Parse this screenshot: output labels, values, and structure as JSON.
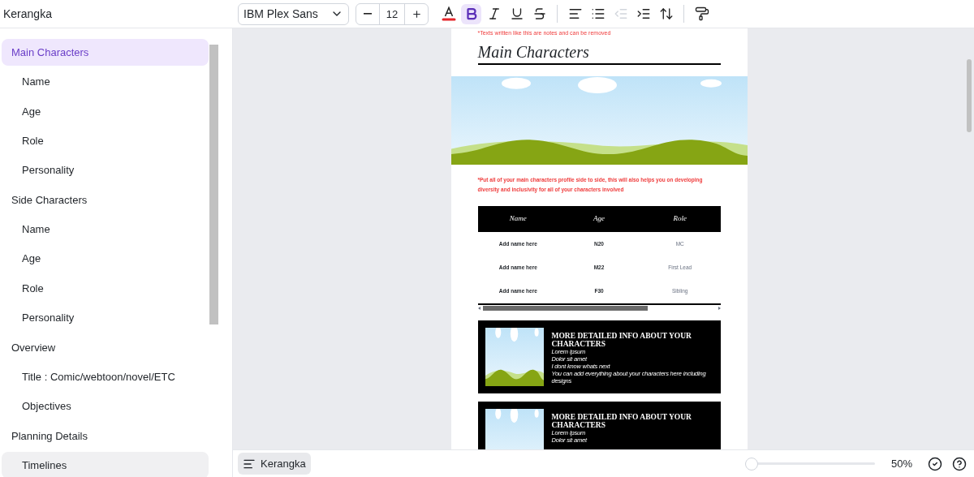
{
  "sidebar": {
    "title": "Kerangka",
    "items": [
      {
        "label": "Main Characters",
        "selected": true,
        "hovered": false,
        "children": [
          {
            "label": "Name",
            "selected": false,
            "hovered": false
          },
          {
            "label": "Age",
            "selected": false,
            "hovered": false
          },
          {
            "label": "Role",
            "selected": false,
            "hovered": false
          },
          {
            "label": "Personality",
            "selected": false,
            "hovered": false
          }
        ]
      },
      {
        "label": "Side Characters",
        "selected": false,
        "hovered": false,
        "children": [
          {
            "label": "Name",
            "selected": false,
            "hovered": false
          },
          {
            "label": "Age",
            "selected": false,
            "hovered": false
          },
          {
            "label": "Role",
            "selected": false,
            "hovered": false
          },
          {
            "label": "Personality",
            "selected": false,
            "hovered": false
          }
        ]
      },
      {
        "label": "Overview",
        "selected": false,
        "hovered": false,
        "children": [
          {
            "label": "Title : Comic/webtoon/novel/ETC",
            "selected": false,
            "hovered": false
          },
          {
            "label": "Objectives",
            "selected": false,
            "hovered": false
          }
        ]
      },
      {
        "label": "Planning Details",
        "selected": false,
        "hovered": false,
        "children": [
          {
            "label": "Timelines",
            "selected": false,
            "hovered": true
          }
        ]
      }
    ]
  },
  "toolbar": {
    "font": "IBM Plex Sans",
    "size": "12",
    "tools": [
      {
        "kind": "text-color",
        "selected": false,
        "disabled": false
      },
      {
        "kind": "bold",
        "selected": true,
        "disabled": false
      },
      {
        "kind": "italic",
        "selected": false,
        "disabled": false
      },
      {
        "kind": "underline",
        "selected": false,
        "disabled": false
      },
      {
        "kind": "strikethrough",
        "selected": false,
        "disabled": false
      },
      {
        "kind": "separator"
      },
      {
        "kind": "align-left",
        "selected": false,
        "disabled": false
      },
      {
        "kind": "bullet-list",
        "selected": false,
        "disabled": false
      },
      {
        "kind": "outdent",
        "selected": false,
        "disabled": true
      },
      {
        "kind": "indent",
        "selected": false,
        "disabled": false
      },
      {
        "kind": "line-spacing",
        "selected": false,
        "disabled": false
      },
      {
        "kind": "separator"
      },
      {
        "kind": "paint-format",
        "selected": false,
        "disabled": false
      }
    ]
  },
  "document": {
    "top_note": "*Texts written like this are notes and can be removed",
    "heading": "Main Characters",
    "note": "*Put all of your main characters profile side to side, this will also helps you on developing diversity and inclusivity for all of your characters involved",
    "table": {
      "columns": [
        "Name",
        "Age",
        "Role"
      ],
      "rows": [
        [
          "Add name here",
          "N20",
          "MC"
        ],
        [
          "Add name here",
          "M22",
          "First Lead"
        ],
        [
          "Add name here",
          "F30",
          "Sibling"
        ]
      ]
    },
    "cards": [
      {
        "title": "MORE DETAILED INFO ABOUT YOUR CHARACTERS",
        "lines": [
          "Lorem Ipsum",
          "Dolor sit amet",
          "I dont know whats next",
          "You can add everything about your characters here including designs"
        ]
      },
      {
        "title": "MORE DETAILED INFO ABOUT YOUR CHARACTERS",
        "lines": [
          "Lorem Ipsum",
          "Dolor sit amet"
        ]
      }
    ]
  },
  "footer": {
    "outline_button": "Kerangka",
    "zoom": {
      "level": 0,
      "reading": "50%"
    }
  }
}
